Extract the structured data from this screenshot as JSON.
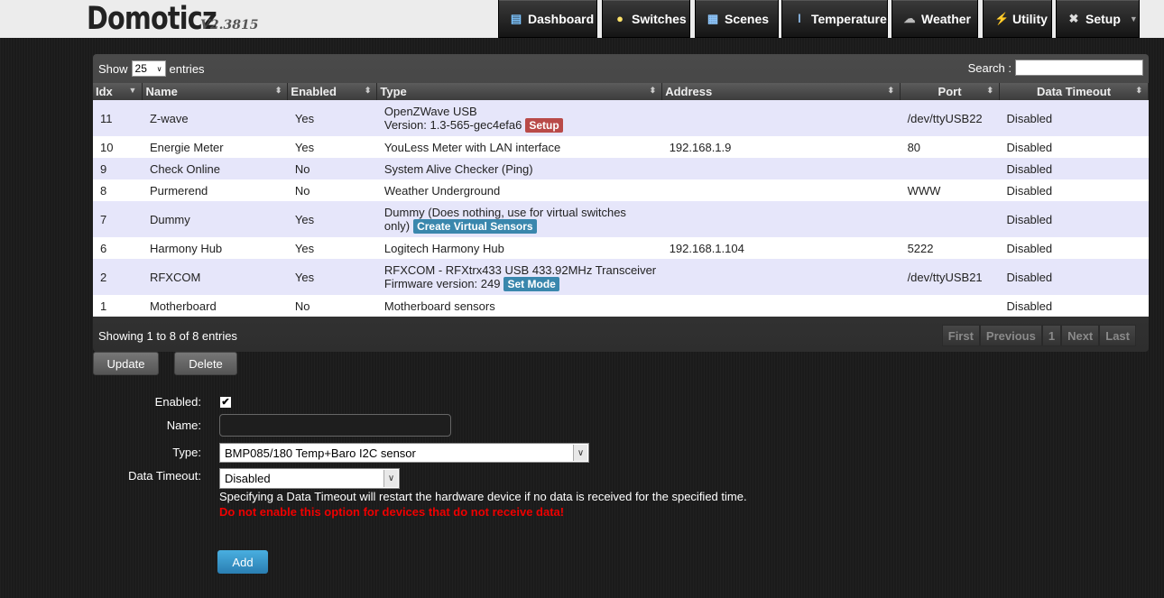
{
  "app": {
    "logo": "Domoticz",
    "version": "V2.3815"
  },
  "nav": [
    {
      "label": "Dashboard",
      "icon": "dashboard-icon",
      "glyph": "▤"
    },
    {
      "label": "Switches",
      "icon": "lightbulb-icon",
      "glyph": "💡"
    },
    {
      "label": "Scenes",
      "icon": "clapperboard-icon",
      "glyph": "🎬"
    },
    {
      "label": "Temperature",
      "icon": "thermometer-icon",
      "glyph": "🌡"
    },
    {
      "label": "Weather",
      "icon": "cloud-icon",
      "glyph": "☁"
    },
    {
      "label": "Utility",
      "icon": "battery-icon",
      "glyph": "⚡"
    },
    {
      "label": "Setup",
      "icon": "tools-icon",
      "glyph": "✖"
    }
  ],
  "table": {
    "show_label": "Show",
    "entries_label": "entries",
    "page_size": "25",
    "search_label": "Search :",
    "columns": [
      "Idx",
      "Name",
      "Enabled",
      "Type",
      "Address",
      "Port",
      "Data Timeout"
    ],
    "rows": [
      {
        "idx": "11",
        "name": "Z-wave",
        "enabled": "Yes",
        "type": "OpenZWave USB",
        "type2": "Version: 1.3-565-gec4efa6",
        "button": "Setup",
        "button_color": "red",
        "address": "",
        "port": "/dev/ttyUSB22",
        "timeout": "Disabled"
      },
      {
        "idx": "10",
        "name": "Energie Meter",
        "enabled": "Yes",
        "type": "YouLess Meter with LAN interface",
        "type2": "",
        "button": "",
        "address": "192.168.1.9",
        "port": "80",
        "timeout": "Disabled"
      },
      {
        "idx": "9",
        "name": "Check Online",
        "enabled": "No",
        "type": "System Alive Checker (Ping)",
        "type2": "",
        "button": "Setup",
        "button_color": "blue",
        "address": "",
        "port": "",
        "timeout": "Disabled"
      },
      {
        "idx": "8",
        "name": "Purmerend",
        "enabled": "No",
        "type": "Weather Underground",
        "type2": "",
        "button": "",
        "address": "",
        "port": "WWW",
        "timeout": "Disabled"
      },
      {
        "idx": "7",
        "name": "Dummy",
        "enabled": "Yes",
        "type": "Dummy (Does nothing, use for virtual switches",
        "type2": "only)",
        "button": "Create Virtual Sensors",
        "button_color": "blue",
        "address": "",
        "port": "",
        "timeout": "Disabled"
      },
      {
        "idx": "6",
        "name": "Harmony Hub",
        "enabled": "Yes",
        "type": "Logitech Harmony Hub",
        "type2": "",
        "button": "",
        "address": "192.168.1.104",
        "port": "5222",
        "timeout": "Disabled"
      },
      {
        "idx": "2",
        "name": "RFXCOM",
        "enabled": "Yes",
        "type": "RFXCOM - RFXtrx433 USB 433.92MHz Transceiver",
        "type2": "Firmware version: 249",
        "button": "Set Mode",
        "button_color": "blue",
        "address": "",
        "port": "/dev/ttyUSB21",
        "timeout": "Disabled"
      },
      {
        "idx": "1",
        "name": "Motherboard",
        "enabled": "No",
        "type": "Motherboard sensors",
        "type2": "",
        "button": "",
        "address": "",
        "port": "",
        "timeout": "Disabled"
      }
    ],
    "info": "Showing 1 to 8 of 8 entries",
    "pager": [
      "First",
      "Previous",
      "1",
      "Next",
      "Last"
    ]
  },
  "actions": {
    "update": "Update",
    "delete": "Delete"
  },
  "form": {
    "enabled_label": "Enabled:",
    "enabled_checked": "✔",
    "name_label": "Name:",
    "name_value": "",
    "type_label": "Type:",
    "type_value": "BMP085/180 Temp+Baro I2C sensor",
    "timeout_label": "Data Timeout:",
    "timeout_value": "Disabled",
    "help": "Specifying a Data Timeout will restart the hardware device if no data is received for the specified time.",
    "warning": "Do not enable this option for devices that do not receive data!",
    "add": "Add"
  },
  "colors": {
    "row_odd": "#e6e6fa",
    "warning": "#ee0000",
    "tag_red": "#b94a48",
    "tag_blue": "#3a87ad",
    "add_button": "#2a7eb2"
  }
}
